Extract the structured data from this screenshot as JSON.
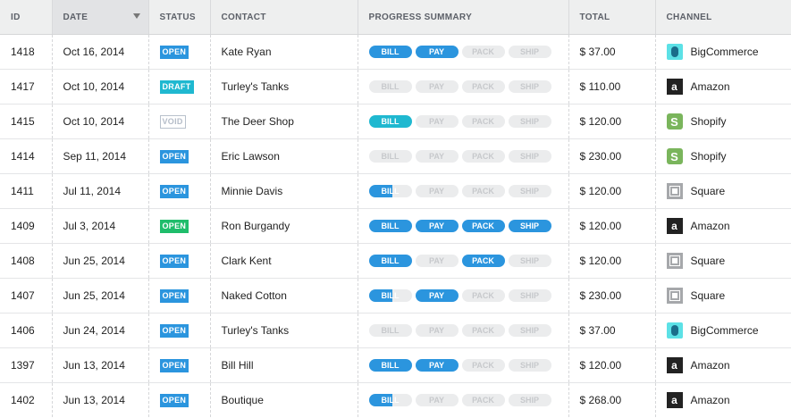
{
  "columns": {
    "id": "ID",
    "date": "DATE",
    "status": "STATUS",
    "contact": "CONTACT",
    "progress": "PROGRESS SUMMARY",
    "total": "TOTAL",
    "channel": "CHANNEL"
  },
  "progress_labels": [
    "BILL",
    "PAY",
    "PACK",
    "SHIP"
  ],
  "colors": {
    "accent_blue": "#2b95de",
    "teal": "#1fb8d0",
    "green": "#1fbd6b"
  },
  "orders": [
    {
      "id": "1418",
      "date": "Oct 16, 2014",
      "status": "OPEN",
      "status_style": "open",
      "contact": "Kate Ryan",
      "progress": [
        1,
        1,
        0,
        0
      ],
      "progress_style": "blue",
      "total": "$ 37.00",
      "channel": "BigCommerce",
      "channel_icon": "bigcommerce"
    },
    {
      "id": "1417",
      "date": "Oct 10, 2014",
      "status": "DRAFT",
      "status_style": "draft",
      "contact": "Turley's Tanks",
      "progress": [
        0,
        0,
        0,
        0
      ],
      "progress_style": "blue",
      "total": "$ 110.00",
      "channel": "Amazon",
      "channel_icon": "amazon"
    },
    {
      "id": "1415",
      "date": "Oct 10, 2014",
      "status": "VOID",
      "status_style": "void",
      "contact": "The Deer Shop",
      "progress": [
        1,
        0,
        0,
        0
      ],
      "progress_style": "teal",
      "total": "$ 120.00",
      "channel": "Shopify",
      "channel_icon": "shopify"
    },
    {
      "id": "1414",
      "date": "Sep 11, 2014",
      "status": "OPEN",
      "status_style": "open",
      "contact": "Eric Lawson",
      "progress": [
        0,
        0,
        0,
        0
      ],
      "progress_style": "blue",
      "total": "$ 230.00",
      "channel": "Shopify",
      "channel_icon": "shopify"
    },
    {
      "id": "1411",
      "date": "Jul 11, 2014",
      "status": "OPEN",
      "status_style": "open",
      "contact": "Minnie Davis",
      "progress": [
        0.55,
        0,
        0,
        0
      ],
      "progress_style": "blue",
      "total": "$ 120.00",
      "channel": "Square",
      "channel_icon": "square"
    },
    {
      "id": "1409",
      "date": "Jul 3, 2014",
      "status": "OPEN",
      "status_style": "open-green",
      "contact": "Ron Burgandy",
      "progress": [
        1,
        1,
        1,
        1
      ],
      "progress_style": "blue",
      "total": "$ 120.00",
      "channel": "Amazon",
      "channel_icon": "amazon"
    },
    {
      "id": "1408",
      "date": "Jun 25, 2014",
      "status": "OPEN",
      "status_style": "open",
      "contact": "Clark Kent",
      "progress": [
        1,
        0,
        1,
        0
      ],
      "progress_style": "blue",
      "total": "$ 120.00",
      "channel": "Square",
      "channel_icon": "square"
    },
    {
      "id": "1407",
      "date": "Jun 25, 2014",
      "status": "OPEN",
      "status_style": "open",
      "contact": "Naked Cotton",
      "progress": [
        0.55,
        1,
        0,
        0
      ],
      "progress_style": "blue",
      "total": "$ 230.00",
      "channel": "Square",
      "channel_icon": "square"
    },
    {
      "id": "1406",
      "date": "Jun 24, 2014",
      "status": "OPEN",
      "status_style": "open",
      "contact": "Turley's Tanks",
      "progress": [
        0,
        0,
        0,
        0
      ],
      "progress_style": "blue",
      "total": "$ 37.00",
      "channel": "BigCommerce",
      "channel_icon": "bigcommerce"
    },
    {
      "id": "1397",
      "date": "Jun 13, 2014",
      "status": "OPEN",
      "status_style": "open",
      "contact": "Bill Hill",
      "progress": [
        1,
        1,
        0,
        0
      ],
      "progress_style": "blue",
      "total": "$ 120.00",
      "channel": "Amazon",
      "channel_icon": "amazon"
    },
    {
      "id": "1402",
      "date": "Jun 13, 2014",
      "status": "OPEN",
      "status_style": "open",
      "contact": "Boutique",
      "progress": [
        0.55,
        0,
        0,
        0
      ],
      "progress_style": "blue",
      "total": "$ 268.00",
      "channel": "Amazon",
      "channel_icon": "amazon"
    }
  ]
}
